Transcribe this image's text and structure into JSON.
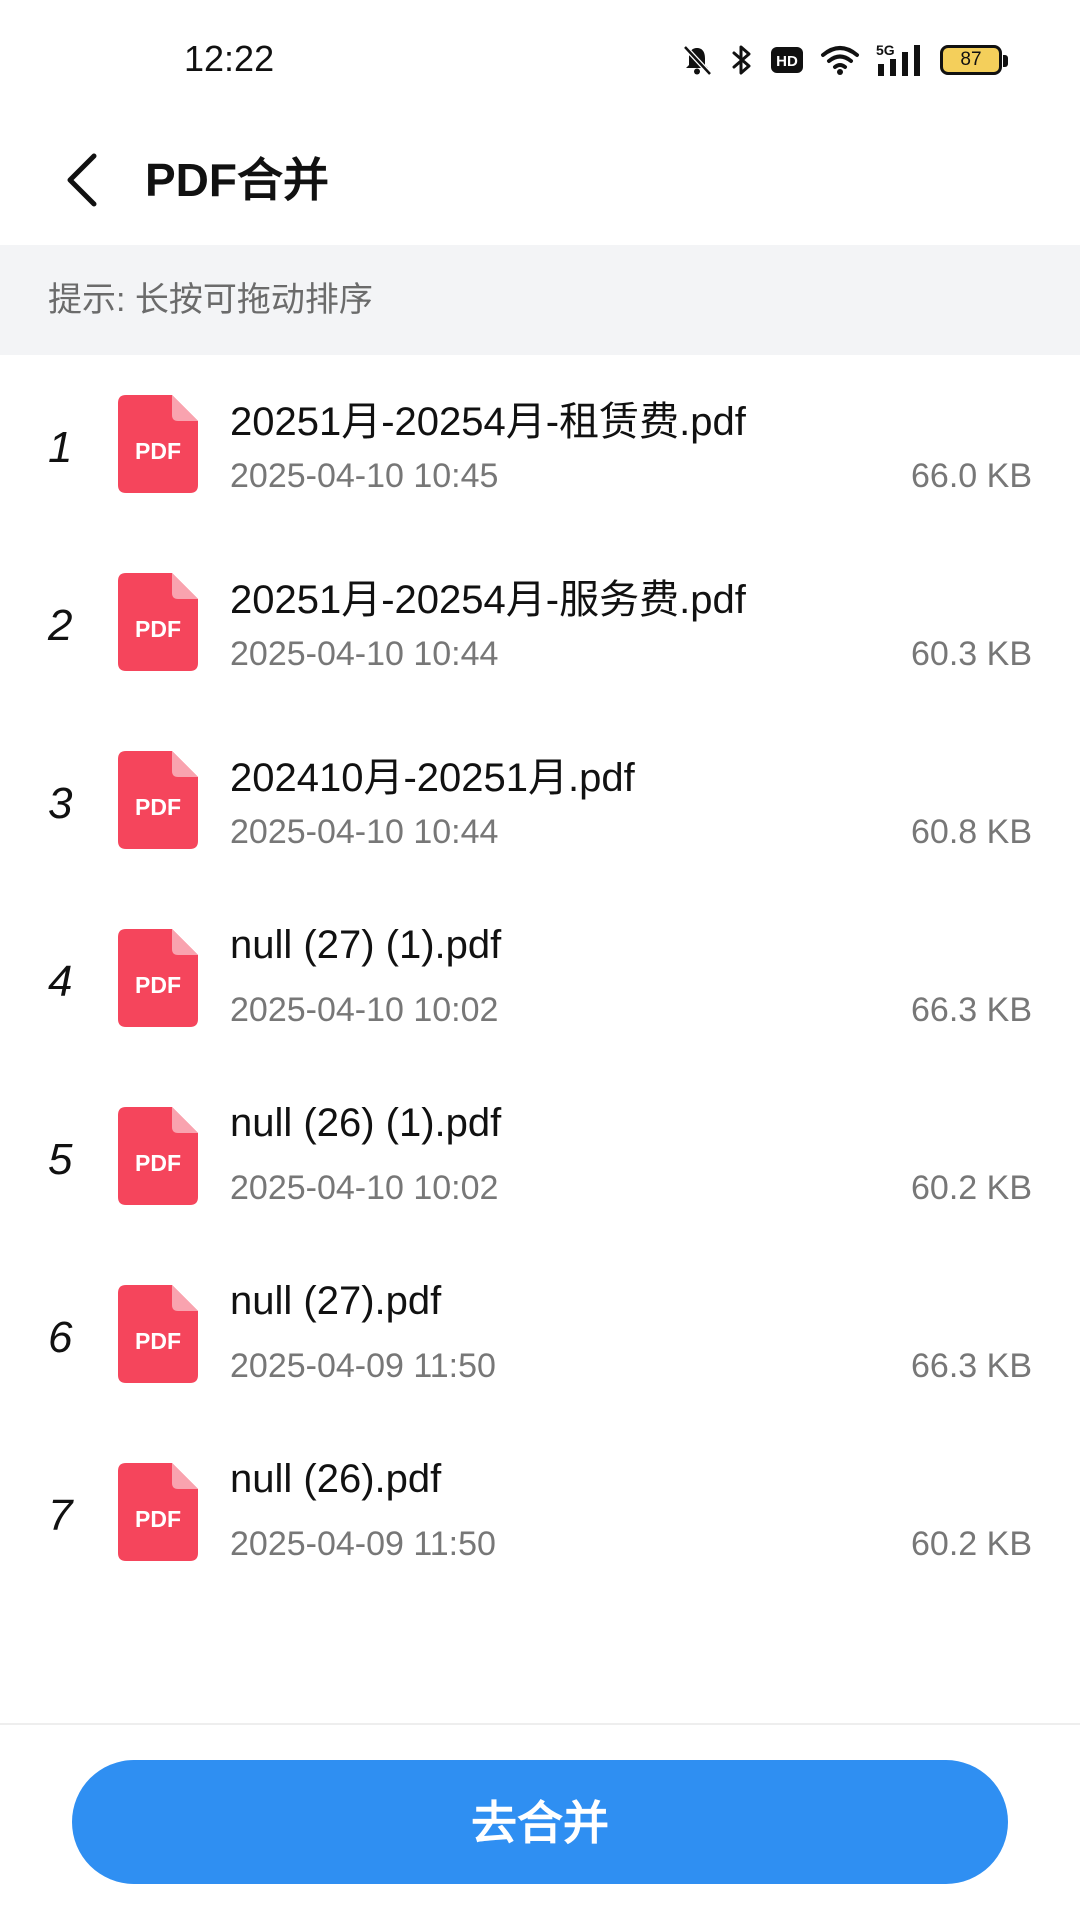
{
  "status_bar": {
    "time": "12:22",
    "icons": [
      "bell-off-icon",
      "bluetooth-icon",
      "hd-icon",
      "wifi-icon",
      "5g-signal-icon",
      "battery-icon"
    ],
    "network": "5G",
    "hd_label": "HD",
    "battery_level": "87",
    "battery_color": "#f4cf5b"
  },
  "header": {
    "back_icon": "chevron-left-icon",
    "title": "PDF合并"
  },
  "hint": {
    "text": "提示: 长按可拖动排序"
  },
  "pdf_icon_label": "PDF",
  "pdf_icon_color": "#f5455c",
  "files": [
    {
      "index": "1",
      "name": "20251月-20254月-租赁费.pdf",
      "date": "2025-04-10 10:45",
      "size": "66.0 KB"
    },
    {
      "index": "2",
      "name": "20251月-20254月-服务费.pdf",
      "date": "2025-04-10 10:44",
      "size": "60.3 KB"
    },
    {
      "index": "3",
      "name": "202410月-20251月.pdf",
      "date": "2025-04-10 10:44",
      "size": "60.8 KB"
    },
    {
      "index": "4",
      "name": "null (27) (1).pdf",
      "date": "2025-04-10 10:02",
      "size": "66.3 KB"
    },
    {
      "index": "5",
      "name": "null (26) (1).pdf",
      "date": "2025-04-10 10:02",
      "size": "60.2 KB"
    },
    {
      "index": "6",
      "name": "null (27).pdf",
      "date": "2025-04-09 11:50",
      "size": "66.3 KB"
    },
    {
      "index": "7",
      "name": "null (26).pdf",
      "date": "2025-04-09 11:50",
      "size": "60.2 KB"
    }
  ],
  "footer": {
    "merge_label": "去合并",
    "button_color": "#2f8ff2"
  }
}
